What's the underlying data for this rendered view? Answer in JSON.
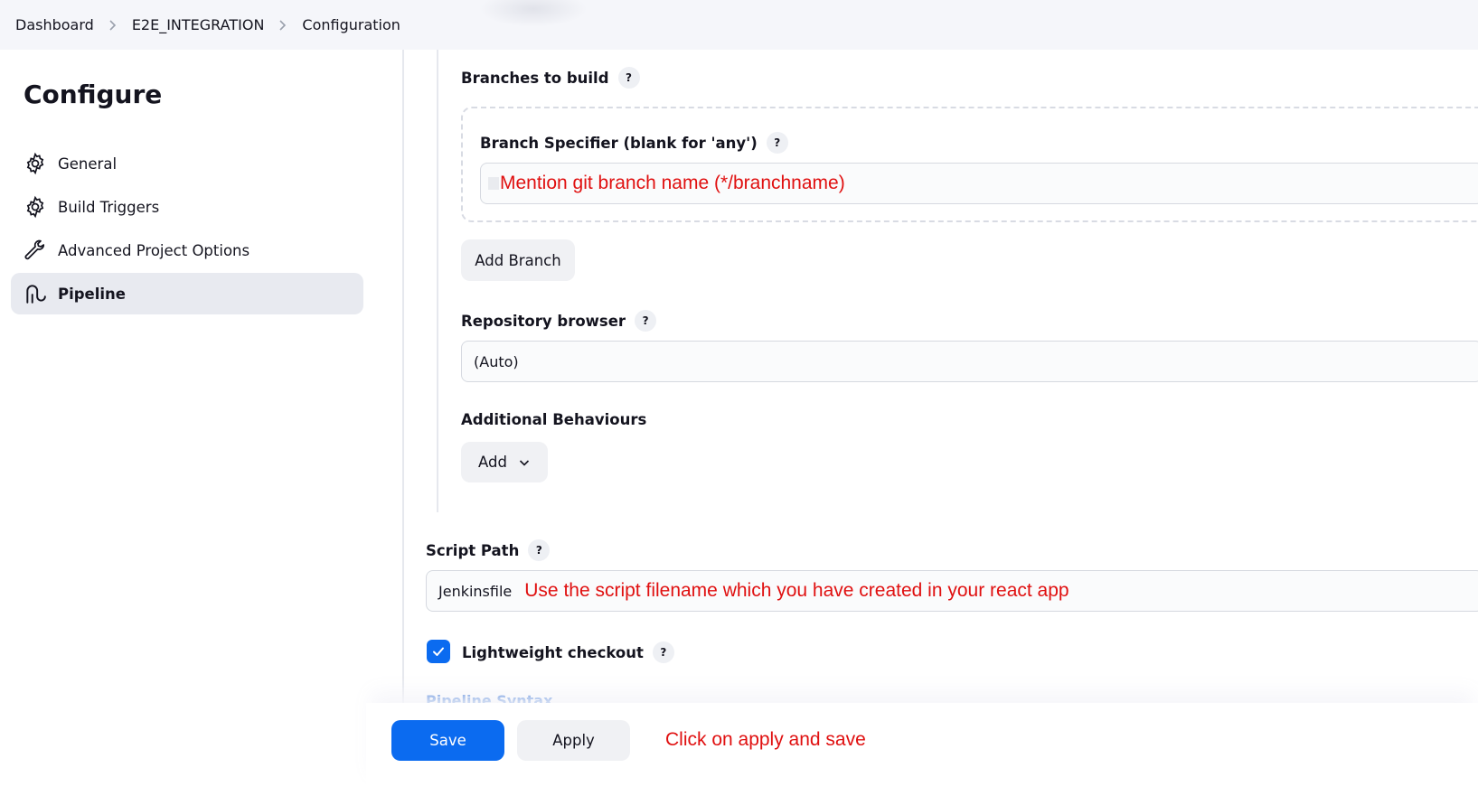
{
  "breadcrumb": {
    "items": [
      "Dashboard",
      "E2E_INTEGRATION",
      "Configuration"
    ]
  },
  "sidebar": {
    "title": "Configure",
    "items": [
      {
        "label": "General",
        "icon": "gear-icon"
      },
      {
        "label": "Build Triggers",
        "icon": "gear-icon"
      },
      {
        "label": "Advanced Project Options",
        "icon": "wrench-icon"
      },
      {
        "label": "Pipeline",
        "icon": "pipeline-icon",
        "active": true
      }
    ]
  },
  "branches": {
    "label": "Branches to build",
    "specifier_label": "Branch Specifier (blank for 'any')",
    "specifier_value": "",
    "specifier_annotation": "Mention git branch name (*/branchname)",
    "add_branch": "Add Branch"
  },
  "repository_browser": {
    "label": "Repository browser",
    "value": "(Auto)"
  },
  "additional_behaviours": {
    "label": "Additional Behaviours",
    "add": "Add"
  },
  "script_path": {
    "label": "Script Path",
    "value": "Jenkinsfile",
    "annotation": "Use the script filename which you have created in your react app"
  },
  "lightweight_checkout": {
    "label": "Lightweight checkout",
    "checked": true
  },
  "pipeline_syntax": "Pipeline Syntax",
  "footer": {
    "save": "Save",
    "apply": "Apply",
    "annotation": "Click on apply and save"
  },
  "help_symbol": "?",
  "colors": {
    "accent": "#0b6bf0",
    "annotation": "#e01010",
    "topbar": "#f5f6fa"
  }
}
